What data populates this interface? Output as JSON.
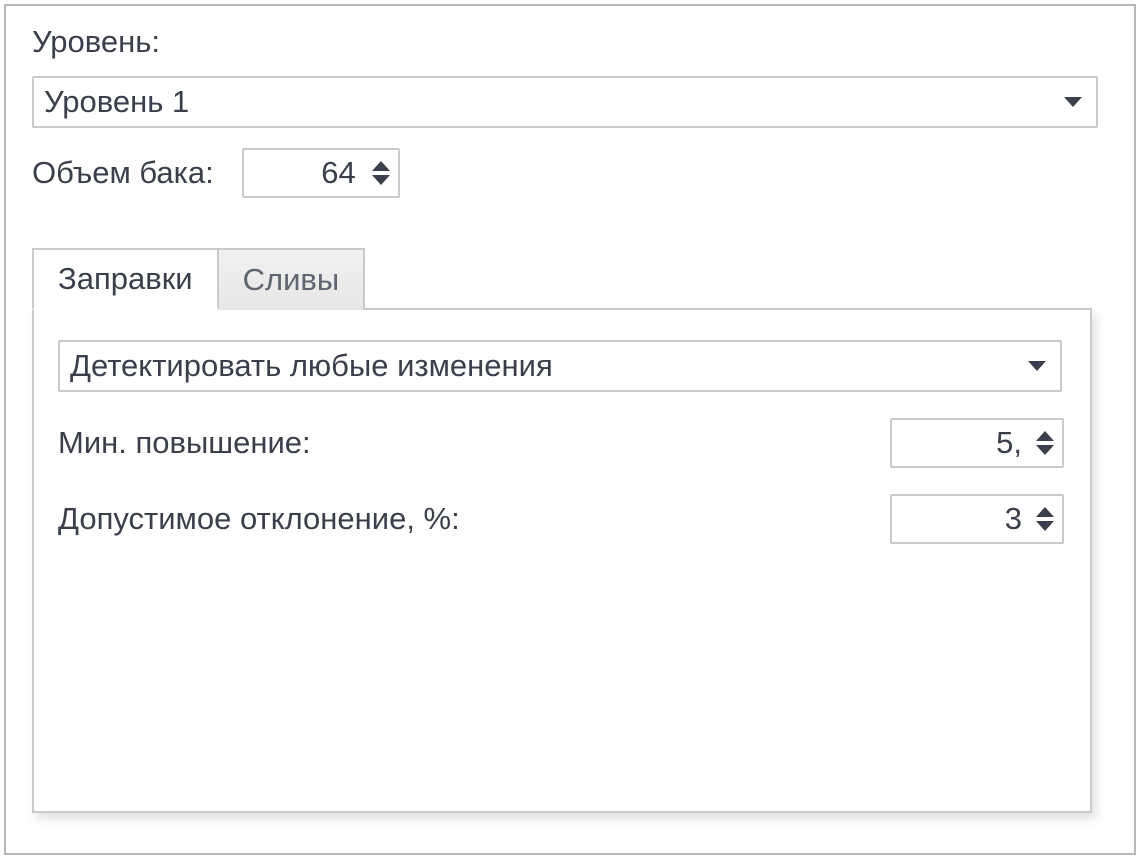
{
  "top": {
    "level_label": "Уровень:",
    "level_value": "Уровень 1",
    "volume_label": "Объем бака:",
    "volume_value": "64"
  },
  "tabs": {
    "refills": "Заправки",
    "drains": "Сливы"
  },
  "refills_panel": {
    "mode_value": "Детектировать любые изменения",
    "min_increase_label": "Мин. повышение:",
    "min_increase_value": "5,",
    "tolerance_label": "Допустимое отклонение, %:",
    "tolerance_value": "3"
  }
}
